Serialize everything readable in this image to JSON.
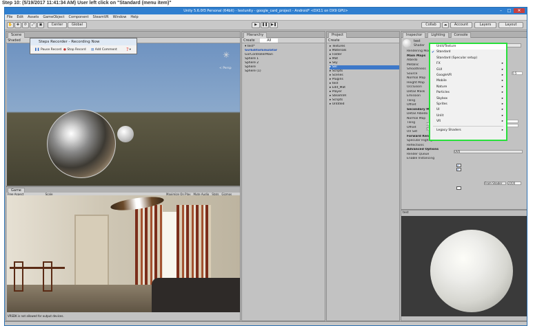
{
  "caption": "Step 10: (5/19/2017 11:41:34 AM) User left click on \"Standard (menu item)\"",
  "window": {
    "title": "Unity 5.6.0f3 Personal (64bit) - testunity - google_card_project - Android* <DX11 on DX9 GPU>",
    "menu": [
      "File",
      "Edit",
      "Assets",
      "GameObject",
      "Component",
      "SteamVR",
      "Window",
      "Help"
    ]
  },
  "toolbar": {
    "center": "Center",
    "global": "Global",
    "collab": "Collab",
    "account": "Account",
    "layers": "Layers",
    "layout": "Layout"
  },
  "recorder": {
    "title": "Steps Recorder - Recording Now",
    "pause": "Pause Record",
    "stop": "Stop Record",
    "comment": "Add Comment"
  },
  "scene": {
    "tab": "Scene",
    "shaded": "Shaded",
    "persp": "< Persp"
  },
  "game": {
    "tab": "Game",
    "aspect": "Free Aspect",
    "scale": "Scale",
    "options": [
      "Maximize On Play",
      "Mute Audio",
      "Stats",
      "Gizmos"
    ]
  },
  "hierarchy": {
    "tab": "Hierarchy",
    "create": "Create",
    "search": "All",
    "items": [
      "test*",
      "GvrEditorEmulator",
      "GvrControllerMain",
      "Sphere 1",
      "Sphere 2",
      "Sphere",
      "Sphere (1)"
    ]
  },
  "project": {
    "tab": "Project",
    "create": "Create",
    "items": [
      "Textures",
      "Materials",
      "Folder",
      "Mat",
      "Sky",
      "Sel",
      "Scripts",
      "Scenes",
      "Plugins",
      "test",
      "Edit_Mat",
      "Player",
      "SteamVR",
      "Scripts",
      "Untitled"
    ]
  },
  "inspector": {
    "tabs": [
      "Inspector",
      "Lighting",
      "Console"
    ],
    "name": "test",
    "shader_label": "Shader",
    "shader_value": "Standard",
    "rows": [
      "Rendering Mode",
      "Main Maps",
      "Albedo",
      "Metallic",
      "Smoothness",
      "Source",
      "Normal Map",
      "Height Map",
      "Occlusion",
      "Detail Mask",
      "Emission",
      "Tiling",
      "Offset",
      "Secondary Maps",
      "Detail Albedo x2",
      "Normal Map",
      "Tiling",
      "Offset",
      "UV Set",
      "Forward Rendering Options",
      "Specular Highlights",
      "Reflections",
      "Advanced Options",
      "Render Queue",
      "Enable Instancing"
    ],
    "uv_value": "UV0",
    "queue_value": "From Shader",
    "queue_num": "2000",
    "tiling_x": "1",
    "tiling_y": "1",
    "offset_x": "0",
    "offset_y": "0",
    "smooth_value": "0.5",
    "preview_label": "test"
  },
  "shader_menu": {
    "items": [
      {
        "label": "Unlit/Texture",
        "hover": true
      },
      {
        "label": "Standard",
        "checked": true
      },
      {
        "label": "Standard (Specular setup)"
      },
      {
        "label": "FX",
        "sub": true
      },
      {
        "label": "GUI",
        "sub": true
      },
      {
        "label": "GoogleVR",
        "sub": true
      },
      {
        "label": "Mobile",
        "sub": true
      },
      {
        "label": "Nature",
        "sub": true
      },
      {
        "label": "Particles",
        "sub": true
      },
      {
        "label": "Skybox",
        "sub": true
      },
      {
        "label": "Sprites",
        "sub": true
      },
      {
        "label": "UI",
        "sub": true
      },
      {
        "label": "Unlit",
        "sub": true
      },
      {
        "label": "VR",
        "sub": true
      },
      {
        "label": "Legacy Shaders",
        "sub": true
      }
    ]
  },
  "status": "VRSDK is not allowed for output devices."
}
